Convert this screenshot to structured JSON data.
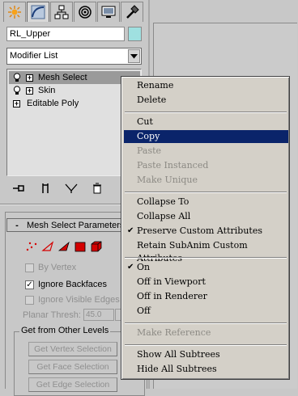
{
  "tabs": [
    {
      "icon": "create-sun-icon",
      "active": false
    },
    {
      "icon": "modify-curve-icon",
      "active": true
    },
    {
      "icon": "hierarchy-icon",
      "active": false
    },
    {
      "icon": "motion-icon",
      "active": false
    },
    {
      "icon": "display-monitor-icon",
      "active": false
    },
    {
      "icon": "utilities-hammer-icon",
      "active": false
    }
  ],
  "object": {
    "name": "RL_Upper",
    "color": "#9fe0e0"
  },
  "modifier_list": {
    "label": "Modifier List"
  },
  "stack": {
    "items": [
      {
        "label": "Mesh Select",
        "selected": true,
        "bulb": true
      },
      {
        "label": "Skin",
        "selected": false,
        "bulb": true
      },
      {
        "label": "Editable Poly",
        "selected": false,
        "bulb": false
      }
    ]
  },
  "rollout": {
    "title": "Mesh Select Parameters",
    "sign": "-",
    "options": [
      {
        "label": "By Vertex",
        "checked": false,
        "enabled": false
      },
      {
        "label": "Ignore Backfaces",
        "checked": true,
        "enabled": true
      },
      {
        "label": "Ignore Visible Edges",
        "checked": false,
        "enabled": false
      }
    ],
    "planar_label": "Planar Thresh:",
    "planar_value": "45.0",
    "group_title": "Get from Other Levels",
    "buttons": [
      "Get Vertex Selection",
      "Get Face Selection",
      "Get Edge Selection"
    ]
  },
  "context_menu": {
    "items": [
      {
        "label": "Rename",
        "state": "normal"
      },
      {
        "label": "Delete",
        "state": "normal"
      },
      {
        "sep": true
      },
      {
        "label": "Cut",
        "state": "normal"
      },
      {
        "label": "Copy",
        "state": "highlighted"
      },
      {
        "label": "Paste",
        "state": "disabled"
      },
      {
        "label": "Paste Instanced",
        "state": "disabled"
      },
      {
        "label": "Make Unique",
        "state": "disabled"
      },
      {
        "sep": true
      },
      {
        "label": "Collapse To",
        "state": "normal"
      },
      {
        "label": "Collapse All",
        "state": "normal"
      },
      {
        "label": "Preserve Custom Attributes",
        "state": "normal",
        "checked": true
      },
      {
        "label": "Retain SubAnim Custom Attributes",
        "state": "normal"
      },
      {
        "sep": true
      },
      {
        "label": "On",
        "state": "normal",
        "checked": true
      },
      {
        "label": "Off in Viewport",
        "state": "normal"
      },
      {
        "label": "Off in Renderer",
        "state": "normal"
      },
      {
        "label": "Off",
        "state": "normal"
      },
      {
        "sep": true
      },
      {
        "label": "Make Reference",
        "state": "disabled"
      },
      {
        "sep": true
      },
      {
        "label": "Show All Subtrees",
        "state": "normal"
      },
      {
        "label": "Hide All Subtrees",
        "state": "normal"
      }
    ]
  }
}
